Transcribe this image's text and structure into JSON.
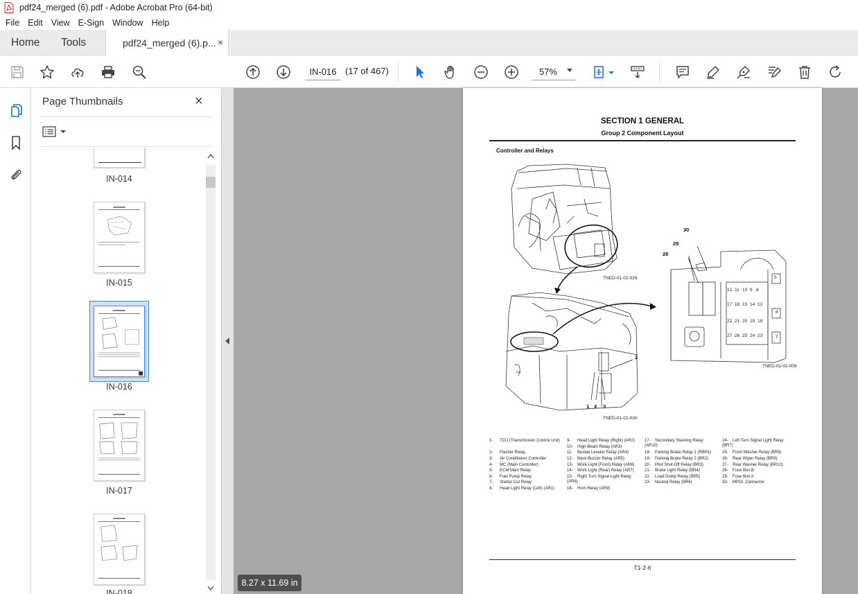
{
  "window": {
    "title": "pdf24_merged (6).pdf - Adobe Acrobat Pro (64-bit)"
  },
  "menu": [
    "File",
    "Edit",
    "View",
    "E-Sign",
    "Window",
    "Help"
  ],
  "tabs": {
    "home": "Home",
    "tools": "Tools",
    "document": "pdf24_merged (6).p...",
    "close": "×"
  },
  "toolbar": {
    "page_label": "IN-016",
    "page_count": "(17 of 467)",
    "zoom": "57%"
  },
  "thumbnails": {
    "title": "Page Thumbnails",
    "close": "×",
    "items": [
      {
        "label": "IN-014"
      },
      {
        "label": "IN-015"
      },
      {
        "label": "IN-016",
        "selected": true
      },
      {
        "label": "IN-017"
      },
      {
        "label": "IN-018"
      }
    ]
  },
  "page": {
    "section_title": "SECTION 1 GENERAL",
    "group_title": "Group 2 Component Layout",
    "sub_heading": "Controller and Relays",
    "fig_codes": [
      "TNED-01-02-029",
      "TNED-01-02-030",
      "TNED-01-02-009"
    ],
    "callouts": [
      "30",
      "29",
      "28",
      "2",
      "1",
      "4",
      "3"
    ],
    "fuse_labels": [
      "12",
      "11",
      "10",
      "9",
      "8",
      "17",
      "16",
      "15",
      "14",
      "13",
      "22",
      "21",
      "20",
      "19",
      "18",
      "27",
      "26",
      "25",
      "24",
      "23",
      "5",
      "6",
      "7"
    ],
    "legend": [
      {
        "num": "1-",
        "text": "TCU (Transmission Control Unit)"
      },
      {
        "num": "2-",
        "text": "Flasher Relay"
      },
      {
        "num": "3-",
        "text": "Air Conditioner Controller"
      },
      {
        "num": "4-",
        "text": "MC (Main Controller)"
      },
      {
        "num": "5-",
        "text": "ECM Main Relay"
      },
      {
        "num": "6-",
        "text": "Fuel Pump Relay"
      },
      {
        "num": "7-",
        "text": "Starter Cut Relay"
      },
      {
        "num": "8-",
        "text": "Head Light Relay (Left) (AR1)"
      },
      {
        "num": "9-",
        "text": "Head Light Relay (Right) (AR2)"
      },
      {
        "num": "10-",
        "text": "High-Beam Relay (AR3)"
      },
      {
        "num": "11-",
        "text": "Bucket Leveler Relay (AR4)"
      },
      {
        "num": "12-",
        "text": "Back Buzzer Relay (AR5)"
      },
      {
        "num": "13-",
        "text": "Work Light (Front) Relay (AR6)"
      },
      {
        "num": "14-",
        "text": "Work Light (Rear) Relay (AR7)"
      },
      {
        "num": "15-",
        "text": "Right Turn Signal Light Relay (AR8)"
      },
      {
        "num": "16-",
        "text": "Horn Relay (AR9)"
      },
      {
        "num": "17-",
        "text": "Secondary Steering Relay (AR10)"
      },
      {
        "num": "18-",
        "text": "Parking Brake Relay 1 (RBR1)"
      },
      {
        "num": "19-",
        "text": "Parking Brake Relay 2 (BR2)"
      },
      {
        "num": "20-",
        "text": "Pilot Shut-Off Relay (BR3)"
      },
      {
        "num": "21-",
        "text": "Brake Light Relay (BR4)"
      },
      {
        "num": "22-",
        "text": "Load Dump Relay (BR5)"
      },
      {
        "num": "23-",
        "text": "Neutral Relay (BR6)"
      },
      {
        "num": "24-",
        "text": "Left Turn Signal Light Relay (BR7)"
      },
      {
        "num": "25-",
        "text": "Front Washer Relay (BR8)"
      },
      {
        "num": "26-",
        "text": "Rear Wiper Relay (BR9)"
      },
      {
        "num": "27-",
        "text": "Rear Washer Relay (BR10)"
      },
      {
        "num": "28-",
        "text": "Fuse Box B"
      },
      {
        "num": "29-",
        "text": "Fuse Box A"
      },
      {
        "num": "30-",
        "text": "MPDr. Connector"
      }
    ],
    "page_number": "T1-2-6"
  },
  "status": {
    "page_size": "8.27 x 11.69 in"
  },
  "colors": {
    "accent": "#1473e6",
    "pdf_red": "#e2231a",
    "doc_bg": "#a8a8a8"
  }
}
